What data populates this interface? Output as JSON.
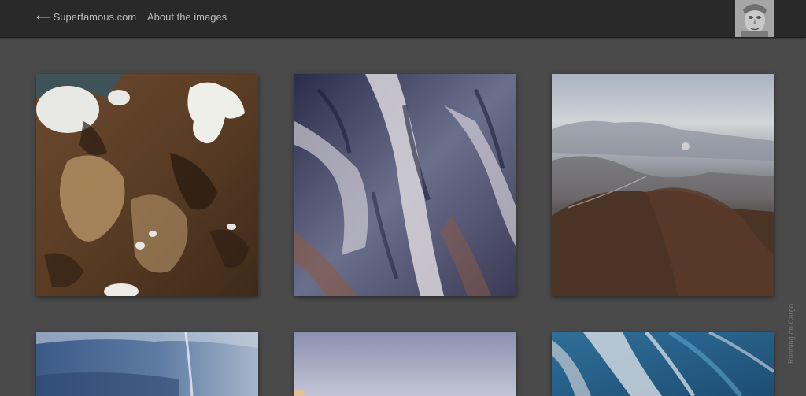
{
  "header": {
    "back_arrow": "⟵",
    "back_label": "Superfamous.com",
    "about_label": "About the images"
  },
  "avatar": {
    "alt": "Profile picture"
  },
  "gallery": {
    "images": [
      {
        "alt": "Aerial view of snow patches over brown terrain"
      },
      {
        "alt": "Aerial view of snow-dusted mountain ridges"
      },
      {
        "alt": "Aerial view of hazy mountain landscape"
      },
      {
        "alt": "Aerial view of blue coastline"
      },
      {
        "alt": "Aerial view of pale sky"
      },
      {
        "alt": "Aerial view of blue river channels"
      }
    ]
  },
  "footer": {
    "cargo_label": "Running on Cargo"
  },
  "colors": {
    "topbar": "#292929",
    "background": "#4a4a4a",
    "link": "#bdbdbd"
  }
}
